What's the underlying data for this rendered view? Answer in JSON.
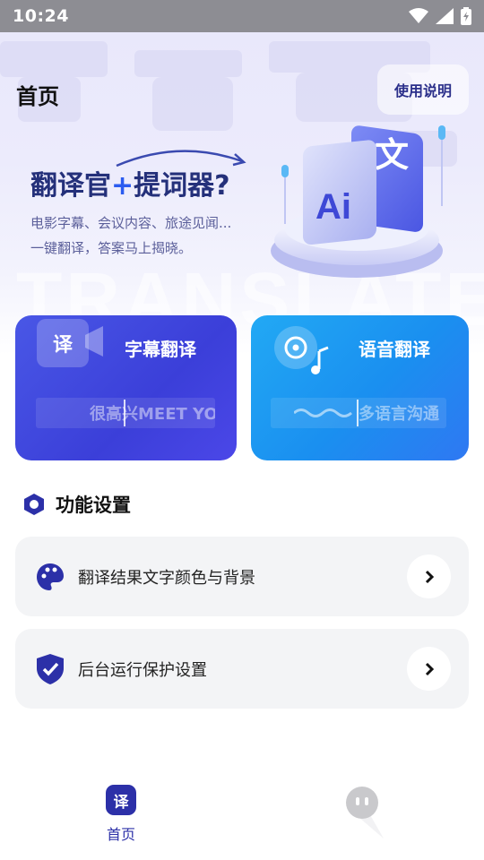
{
  "status_bar": {
    "time": "10:24"
  },
  "header": {
    "title": "首页",
    "help_label": "使用说明"
  },
  "hero": {
    "title_part1": "翻译官",
    "title_plus": "+",
    "title_part2": "提词器?",
    "subtitle_line1": "电影字幕、会议内容、旅途见闻...",
    "subtitle_line2": "一键翻译，答案马上揭晓。",
    "watermark": "TRANSLATE",
    "badge_ai": "Ai",
    "badge_wen": "文"
  },
  "cards": [
    {
      "label": "字幕翻译",
      "icon_text": "译",
      "strip_text": "很高兴MEET YOU",
      "color": "#3d42dc"
    },
    {
      "label": "语音翻译",
      "strip_text": "多语言沟通",
      "color": "#1e95f2"
    }
  ],
  "settings": {
    "section_title": "功能设置",
    "items": [
      {
        "label": "翻译结果文字颜色与背景"
      },
      {
        "label": "后台运行保护设置"
      }
    ]
  },
  "bottom_nav": {
    "home_icon_text": "译",
    "home_label": "首页"
  },
  "colors": {
    "accent": "#2c30a8",
    "brand_blue": "#2b5cf0",
    "row_bg": "#f3f4f6"
  }
}
